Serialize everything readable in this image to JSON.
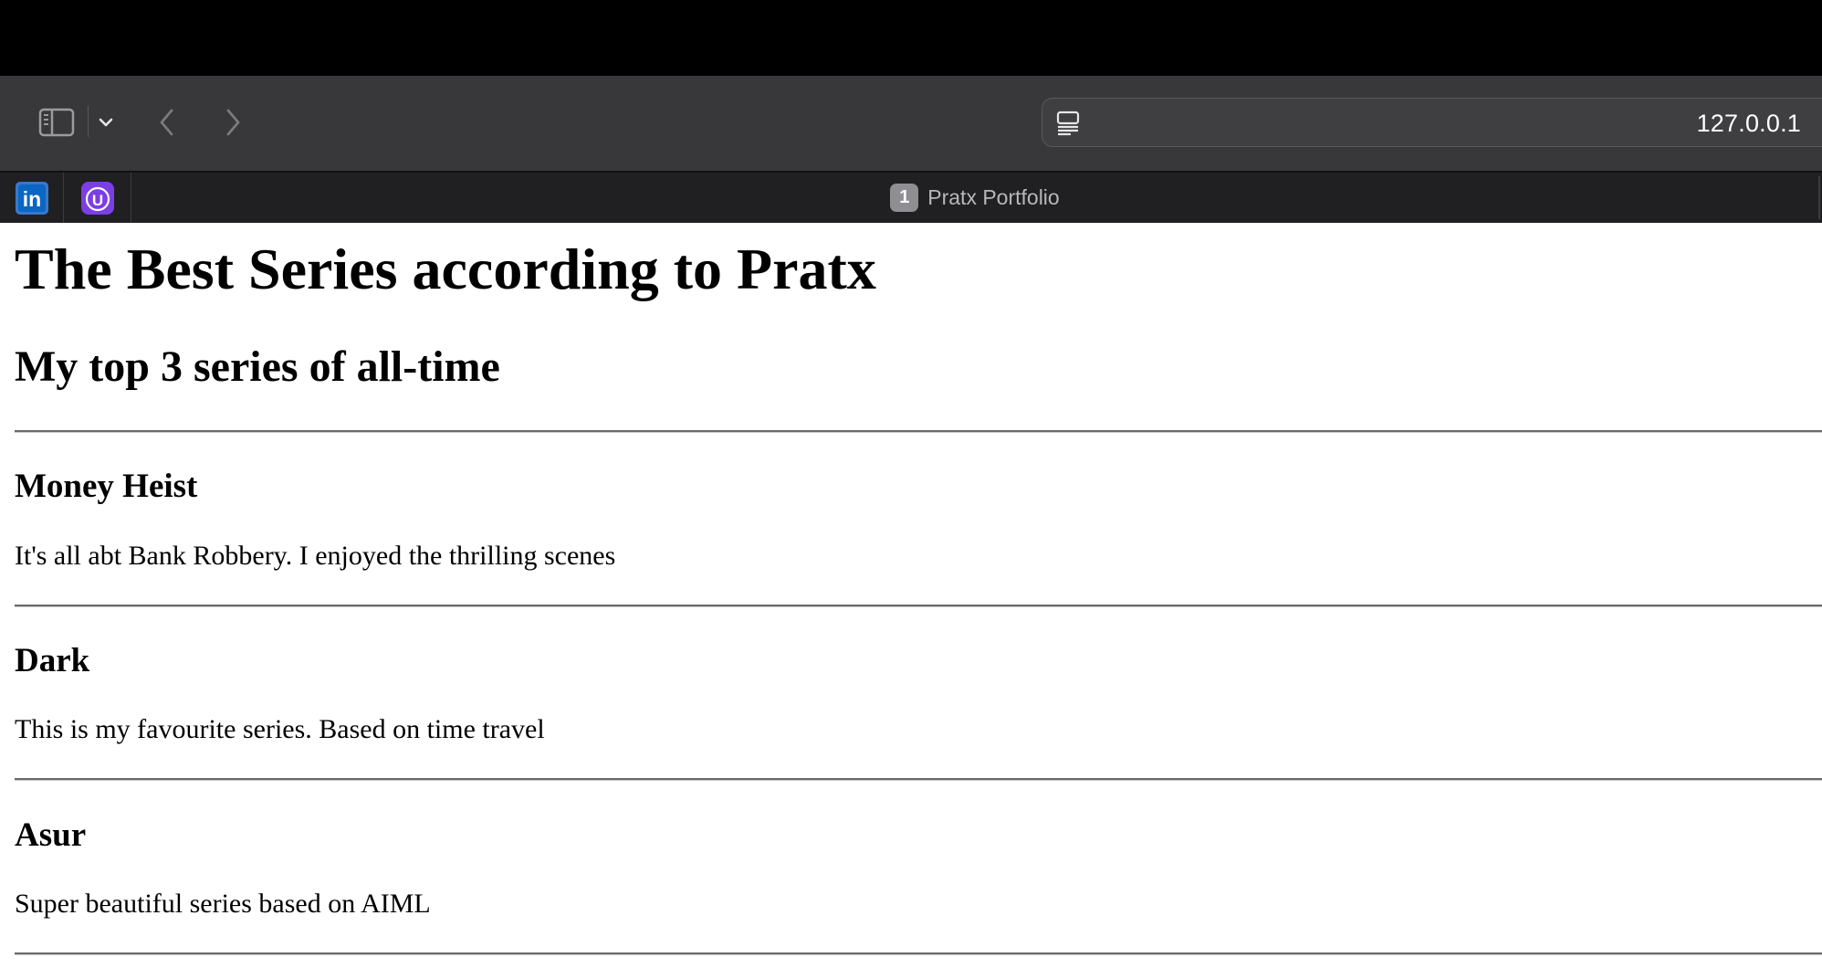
{
  "browser": {
    "url": "127.0.0.1",
    "pinned_tabs": [
      {
        "icon": "linkedin-icon",
        "label": "in"
      },
      {
        "icon": "ucampus-icon",
        "label": "U"
      }
    ],
    "active_tab": {
      "badge": "1",
      "title": "Pratx Portfolio"
    }
  },
  "page": {
    "title": "The Best Series according to Pratx",
    "subtitle": "My top 3 series of all-time",
    "series": [
      {
        "name": "Money Heist",
        "description": "It's all abt Bank Robbery. I enjoyed the thrilling scenes"
      },
      {
        "name": "Dark",
        "description": "This is my favourite series. Based on time travel"
      },
      {
        "name": "Asur",
        "description": "Super beautiful series based on AIML"
      }
    ]
  },
  "colors": {
    "topbar": "#000000",
    "toolbar": "#38383a",
    "tabbar": "#202022",
    "linkedin": "#0a66c2",
    "ucampus": "#7b3fe4"
  }
}
